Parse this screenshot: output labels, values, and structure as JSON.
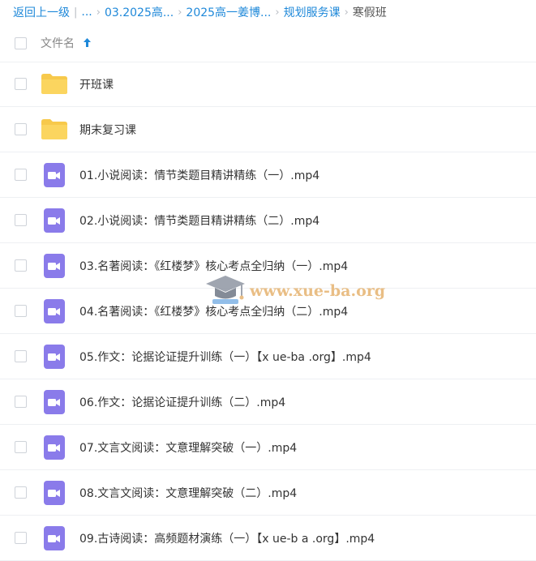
{
  "breadcrumb": {
    "back": "返回上一级",
    "ellipsis": "...",
    "items": [
      "03.2025高...",
      "2025高一姜博...",
      "规划服务课"
    ],
    "current": "寒假班",
    "separator": "›",
    "divider": "|"
  },
  "header": {
    "column_name": "文件名",
    "sort_icon": "arrow-up-icon"
  },
  "files": [
    {
      "name": "开班课",
      "type": "folder"
    },
    {
      "name": "期末复习课",
      "type": "folder"
    },
    {
      "name": "01.小说阅读：情节类题目精讲精练（一）.mp4",
      "type": "video"
    },
    {
      "name": "02.小说阅读：情节类题目精讲精练（二）.mp4",
      "type": "video"
    },
    {
      "name": "03.名著阅读：《红楼梦》核心考点全归纳（一）.mp4",
      "type": "video"
    },
    {
      "name": "04.名著阅读：《红楼梦》核心考点全归纳（二）.mp4",
      "type": "video"
    },
    {
      "name": "05.作文：论据论证提升训练（一）【x ue-ba .org】.mp4",
      "type": "video"
    },
    {
      "name": "06.作文：论据论证提升训练（二）.mp4",
      "type": "video"
    },
    {
      "name": "07.文言文阅读：文意理解突破（一）.mp4",
      "type": "video"
    },
    {
      "name": "08.文言文阅读：文意理解突破（二）.mp4",
      "type": "video"
    },
    {
      "name": "09.古诗阅读：高频题材演练（一）【x ue-b a .org】.mp4",
      "type": "video"
    }
  ],
  "watermark": {
    "text": "www.xue-ba.org"
  },
  "colors": {
    "link": "#1e88d9",
    "folder": "#f7c94b",
    "video": "#8a7bea",
    "watermark": "#e6b370"
  }
}
